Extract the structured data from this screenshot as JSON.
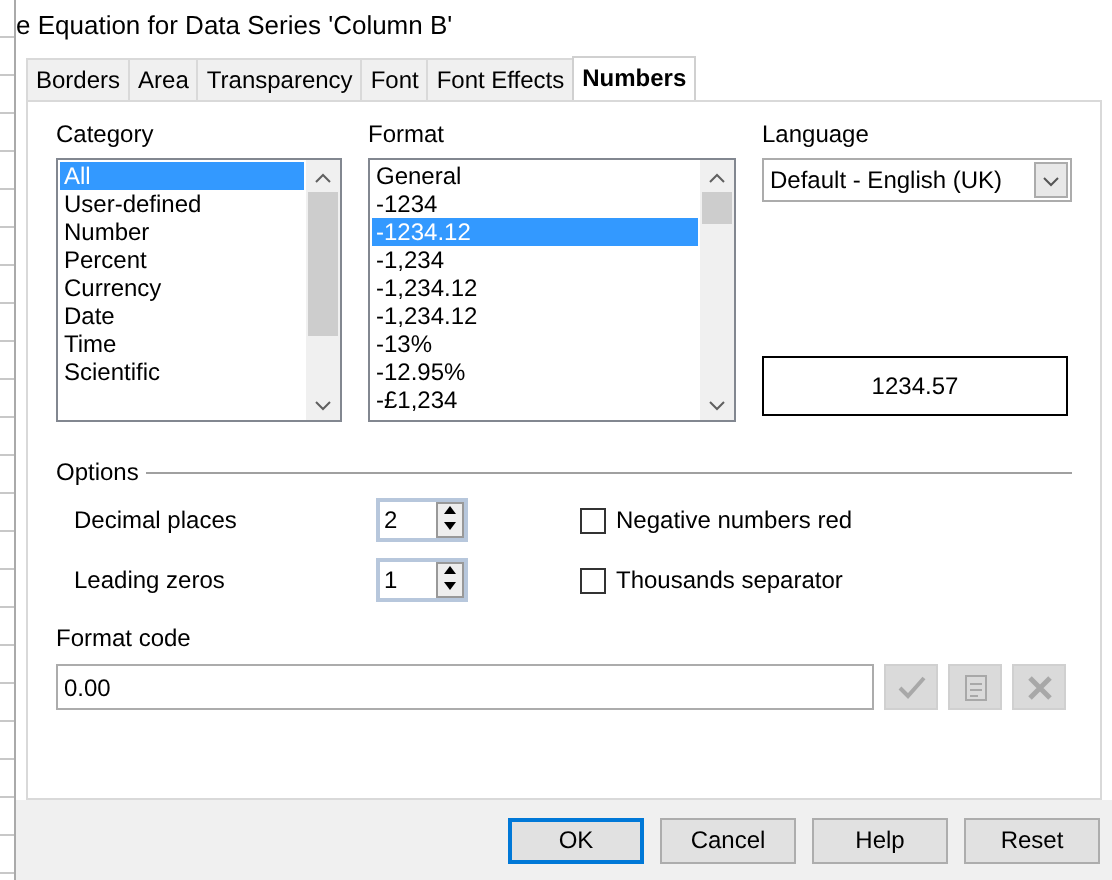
{
  "window": {
    "title": "e Equation for Data Series 'Column B'"
  },
  "tabs": [
    {
      "label": "Borders",
      "selected": false
    },
    {
      "label": "Area",
      "selected": false
    },
    {
      "label": "Transparency",
      "selected": false
    },
    {
      "label": "Font",
      "selected": false
    },
    {
      "label": "Font Effects",
      "selected": false
    },
    {
      "label": "Numbers",
      "selected": true
    }
  ],
  "category": {
    "label": "Category",
    "items": [
      {
        "label": "All",
        "selected": true
      },
      {
        "label": "User-defined",
        "selected": false
      },
      {
        "label": "Number",
        "selected": false
      },
      {
        "label": "Percent",
        "selected": false
      },
      {
        "label": "Currency",
        "selected": false
      },
      {
        "label": "Date",
        "selected": false
      },
      {
        "label": "Time",
        "selected": false
      },
      {
        "label": "Scientific",
        "selected": false
      }
    ]
  },
  "format": {
    "label": "Format",
    "items": [
      {
        "label": "General",
        "selected": false
      },
      {
        "label": "-1234",
        "selected": false
      },
      {
        "label": "-1234.12",
        "selected": true
      },
      {
        "label": "-1,234",
        "selected": false
      },
      {
        "label": "-1,234.12",
        "selected": false
      },
      {
        "label": "-1,234.12",
        "selected": false
      },
      {
        "label": "-13%",
        "selected": false
      },
      {
        "label": "-12.95%",
        "selected": false
      },
      {
        "label": "-£1,234",
        "selected": false
      }
    ]
  },
  "language": {
    "label": "Language",
    "value": "Default - English (UK)"
  },
  "preview": "1234.57",
  "options": {
    "title": "Options",
    "spinners": [
      {
        "label": "Decimal places",
        "value": "2"
      },
      {
        "label": "Leading zeros",
        "value": "1"
      }
    ],
    "checkboxes": [
      {
        "label": "Negative numbers red",
        "checked": false
      },
      {
        "label": "Thousands separator",
        "checked": false
      }
    ]
  },
  "format_code": {
    "label": "Format code",
    "value": "0.00",
    "actions": [
      {
        "kind": "accept",
        "disabled": true
      },
      {
        "kind": "comment",
        "disabled": true
      },
      {
        "kind": "delete",
        "disabled": true
      }
    ]
  },
  "buttons": [
    {
      "label": "OK",
      "default": true
    },
    {
      "label": "Cancel",
      "default": false
    },
    {
      "label": "Help",
      "default": false
    },
    {
      "label": "Reset",
      "default": false
    }
  ]
}
